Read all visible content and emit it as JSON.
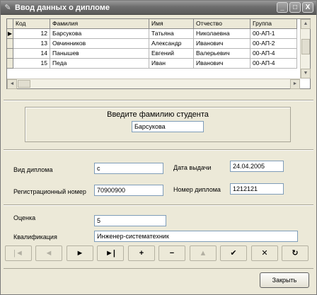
{
  "window": {
    "title": "Ввод данных о дипломе",
    "min_glyph": "_",
    "max_glyph": "□",
    "close_glyph": "X",
    "icon": "pen-icon"
  },
  "grid": {
    "columns": [
      "Код",
      "Фамилия",
      "Имя",
      "Отчество",
      "Группа"
    ],
    "rows": [
      {
        "current": true,
        "code": "12",
        "last": "Барсукова",
        "first": "Татьяна",
        "middle": "Николаевна",
        "group": "00-АП-1"
      },
      {
        "current": false,
        "code": "13",
        "last": "Овчинников",
        "first": "Александр",
        "middle": "Иванович",
        "group": "00-АП-2"
      },
      {
        "current": false,
        "code": "14",
        "last": "Панышев",
        "first": "Евгений",
        "middle": "Валерьевич",
        "group": "00-АП-4"
      },
      {
        "current": false,
        "code": "15",
        "last": "Педа",
        "first": "Иван",
        "middle": "Иванович",
        "group": "00-АП-4"
      }
    ],
    "current_marker": "▶"
  },
  "search": {
    "prompt": "Введите фамилию студента",
    "value": "Барсукова"
  },
  "form": {
    "diploma_type_label": "Вид диплома",
    "diploma_type_value": "с",
    "issue_date_label": "Дата выдачи",
    "issue_date_value": "24.04.2005",
    "reg_number_label": "Регистрационный номер",
    "reg_number_value": "70900900",
    "diploma_number_label": "Номер диплома",
    "diploma_number_value": "1212121",
    "grade_label": "Оценка",
    "grade_value": "5",
    "qualification_label": "Квалификация",
    "qualification_value": "Инженер-систематехник"
  },
  "navigator": [
    {
      "name": "nav-first-button",
      "glyph": "|◄",
      "enabled": false
    },
    {
      "name": "nav-prior-button",
      "glyph": "◄",
      "enabled": false
    },
    {
      "name": "nav-next-button",
      "glyph": "►",
      "enabled": true
    },
    {
      "name": "nav-last-button",
      "glyph": "►|",
      "enabled": true
    },
    {
      "name": "nav-insert-button",
      "glyph": "+",
      "enabled": true
    },
    {
      "name": "nav-delete-button",
      "glyph": "−",
      "enabled": true
    },
    {
      "name": "nav-edit-button",
      "glyph": "▲",
      "enabled": false
    },
    {
      "name": "nav-post-button",
      "glyph": "✔",
      "enabled": true
    },
    {
      "name": "nav-cancel-button",
      "glyph": "✕",
      "enabled": true
    },
    {
      "name": "nav-refresh-button",
      "glyph": "↻",
      "enabled": true
    }
  ],
  "footer": {
    "close_label": "Закрыть"
  }
}
